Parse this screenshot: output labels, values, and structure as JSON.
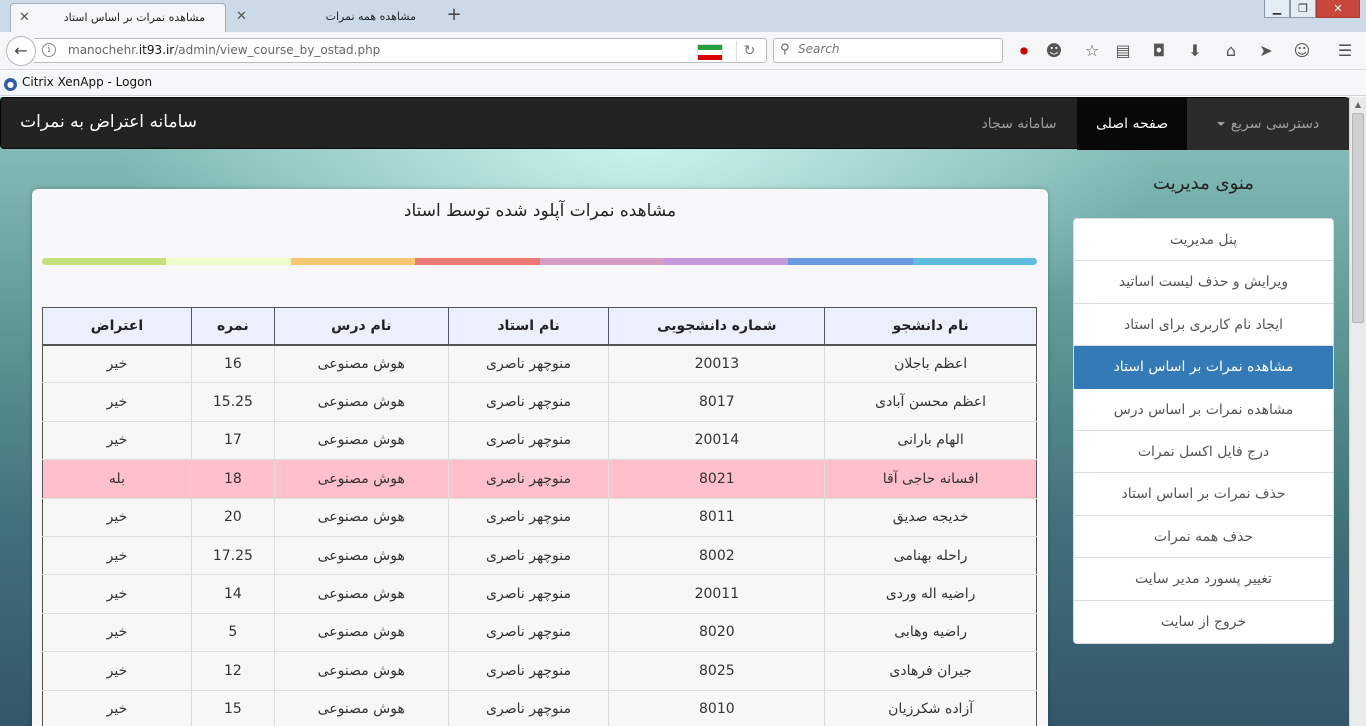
{
  "browser": {
    "tabs": [
      {
        "title": "مشاهده نمرات بر اساس استاد",
        "active": true
      },
      {
        "title": "مشاهده همه نمرات",
        "active": false
      }
    ],
    "close_glyph": "✕",
    "new_tab_glyph": "+",
    "url_prefix": "manochehr.",
    "url_domain": "it93.ir",
    "url_path": "/admin/view_course_by_ostad.php",
    "search_placeholder": "Search",
    "bookmark_label": "Citrix XenApp - Logon"
  },
  "site": {
    "brand": "سامانه اعتراض به نمرات",
    "nav": {
      "quick_access": "دسترسی سریع",
      "home": "صفحه اصلی",
      "sajad": "سامانه سجاد"
    }
  },
  "sidebar": {
    "title": "منوی مدیریت",
    "items": [
      {
        "label": "پنل مدیریت",
        "active": false
      },
      {
        "label": "ویرایش و حذف لیست اساتید",
        "active": false
      },
      {
        "label": "ایجاد نام کاربری برای استاد",
        "active": false
      },
      {
        "label": "مشاهده نمرات بر اساس استاد",
        "active": true
      },
      {
        "label": "مشاهده نمرات بر اساس درس",
        "active": false
      },
      {
        "label": "درج فایل اکسل نمرات",
        "active": false
      },
      {
        "label": "حذف نمرات بر اساس استاد",
        "active": false
      },
      {
        "label": "حذف همه نمرات",
        "active": false
      },
      {
        "label": "تغییر پسورد مدیر سایت",
        "active": false
      },
      {
        "label": "خروج از سایت",
        "active": false
      }
    ]
  },
  "panel": {
    "title": "مشاهده نمرات آپلود شده توسط استاد",
    "stripe_colors": [
      "#60bde0",
      "#6a9ae0",
      "#c59ade",
      "#d89cc4",
      "#ec7a72",
      "#f7c872",
      "#eefec6",
      "#c5e07a"
    ]
  },
  "table": {
    "headers": [
      "نام دانشجو",
      "شماره دانشجویی",
      "نام استاد",
      "نام درس",
      "نمره",
      "اعتراض"
    ],
    "rows": [
      {
        "student": "اعظم باجلان",
        "id": "20013",
        "teacher": "منوچهر ناصری",
        "course": "هوش مصنوعی",
        "grade": "16",
        "objection": "خیر",
        "flagged": false
      },
      {
        "student": "اعظم محسن آبادی",
        "id": "8017",
        "teacher": "منوچهر ناصری",
        "course": "هوش مصنوعی",
        "grade": "15.25",
        "objection": "خیر",
        "flagged": false
      },
      {
        "student": "الهام بارانی",
        "id": "20014",
        "teacher": "منوچهر ناصری",
        "course": "هوش مصنوعی",
        "grade": "17",
        "objection": "خیر",
        "flagged": false
      },
      {
        "student": "افسانه حاجی آقا",
        "id": "8021",
        "teacher": "منوچهر ناصری",
        "course": "هوش مصنوعی",
        "grade": "18",
        "objection": "بله",
        "flagged": true
      },
      {
        "student": "خدیجه صدیق",
        "id": "8011",
        "teacher": "منوچهر ناصری",
        "course": "هوش مصنوعی",
        "grade": "20",
        "objection": "خیر",
        "flagged": false
      },
      {
        "student": "راحله بهنامی",
        "id": "8002",
        "teacher": "منوچهر ناصری",
        "course": "هوش مصنوعی",
        "grade": "17.25",
        "objection": "خیر",
        "flagged": false
      },
      {
        "student": "راضیه اله وردی",
        "id": "20011",
        "teacher": "منوچهر ناصری",
        "course": "هوش مصنوعی",
        "grade": "14",
        "objection": "خیر",
        "flagged": false
      },
      {
        "student": "راضیه وهابی",
        "id": "8020",
        "teacher": "منوچهر ناصری",
        "course": "هوش مصنوعی",
        "grade": "5",
        "objection": "خیر",
        "flagged": false
      },
      {
        "student": "جیران فرهادی",
        "id": "8025",
        "teacher": "منوچهر ناصری",
        "course": "هوش مصنوعی",
        "grade": "12",
        "objection": "خیر",
        "flagged": false
      },
      {
        "student": "آزاده شکرزیان",
        "id": "8010",
        "teacher": "منوچهر ناصری",
        "course": "هوش مصنوعی",
        "grade": "15",
        "objection": "خیر",
        "flagged": false
      }
    ]
  }
}
